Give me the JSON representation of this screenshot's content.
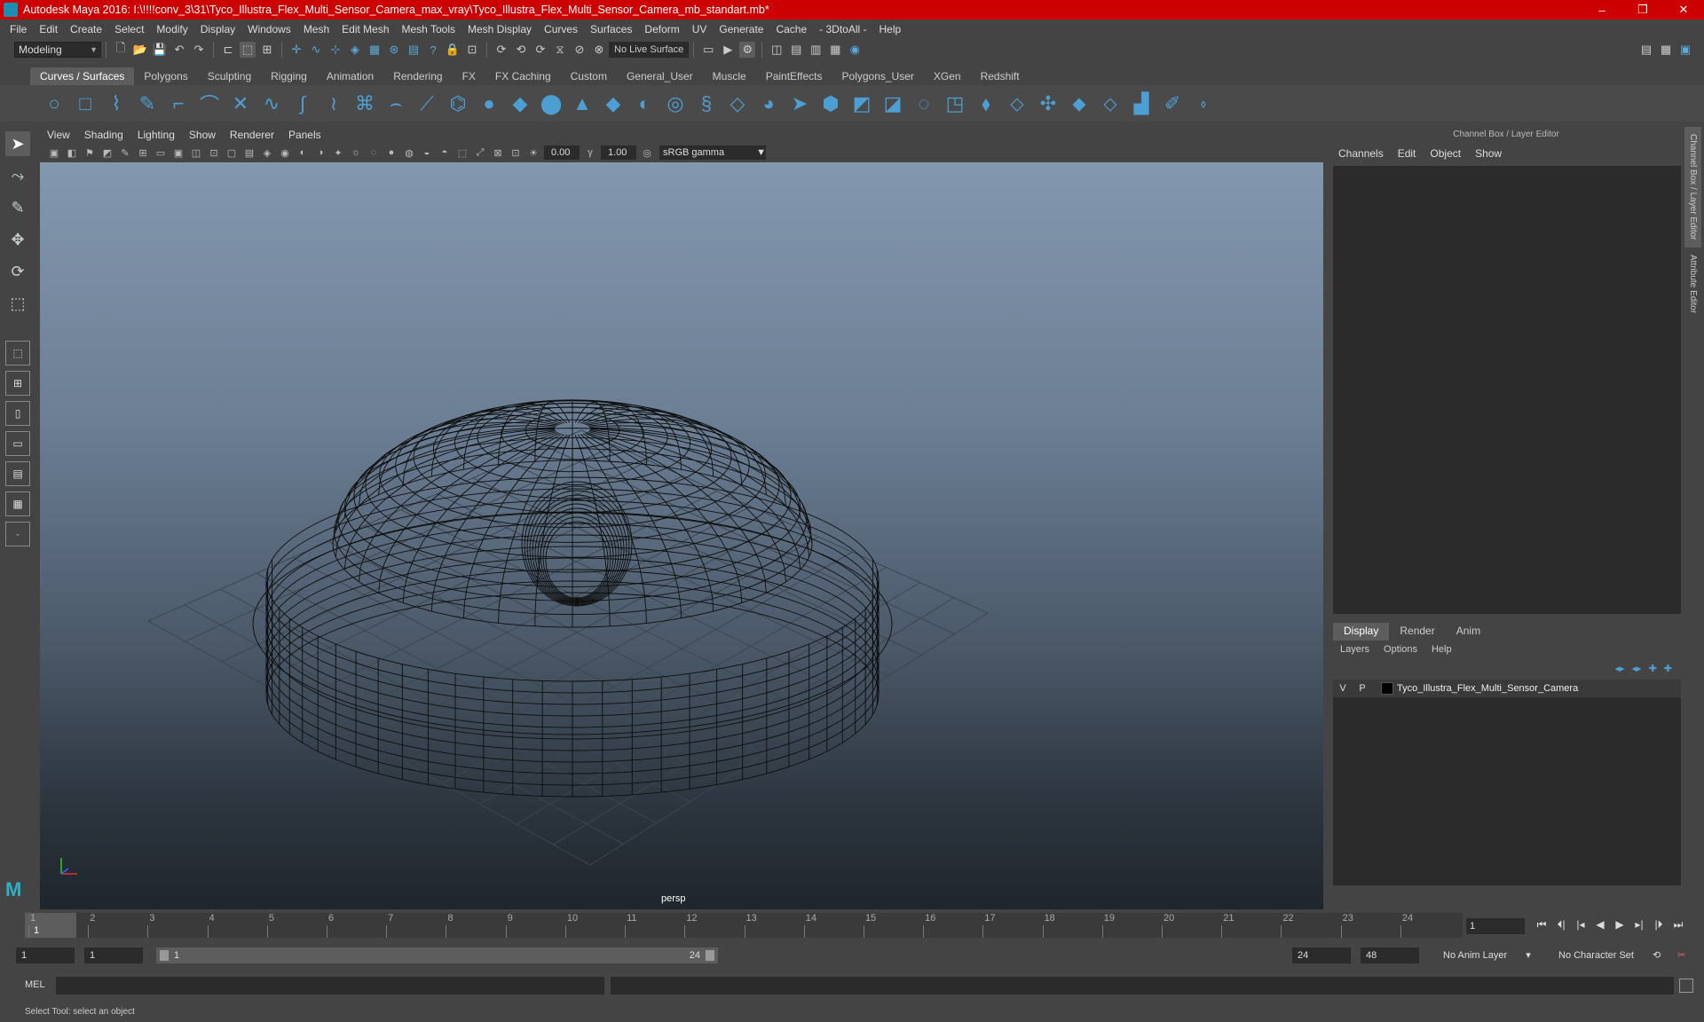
{
  "window": {
    "title": "Autodesk Maya 2016: I:\\!!!!conv_3\\31\\Tyco_Illustra_Flex_Multi_Sensor_Camera_max_vray\\Tyco_Illustra_Flex_Multi_Sensor_Camera_mb_standart.mb*",
    "controls": [
      "–",
      "❐",
      "✕"
    ]
  },
  "menubar": [
    "File",
    "Edit",
    "Create",
    "Select",
    "Modify",
    "Display",
    "Windows",
    "Mesh",
    "Edit Mesh",
    "Mesh Tools",
    "Mesh Display",
    "Curves",
    "Surfaces",
    "Deform",
    "UV",
    "Generate",
    "Cache",
    "- 3DtoAll -",
    "Help"
  ],
  "statusline": {
    "mode": "Modeling",
    "live_surface": "No Live Surface"
  },
  "shelf": {
    "tabs": [
      "Curves / Surfaces",
      "Polygons",
      "Sculpting",
      "Rigging",
      "Animation",
      "Rendering",
      "FX",
      "FX Caching",
      "Custom",
      "General_User",
      "Muscle",
      "PaintEffects",
      "Polygons_User",
      "XGen",
      "Redshift"
    ],
    "active_tab": "Curves / Surfaces"
  },
  "viewport": {
    "menu": [
      "View",
      "Shading",
      "Lighting",
      "Show",
      "Renderer",
      "Panels"
    ],
    "exposure": "0.00",
    "gamma": "1.00",
    "colorspace": "sRGB gamma",
    "camera_label": "persp"
  },
  "channelbox": {
    "header": "Channel Box / Layer Editor",
    "menu": [
      "Channels",
      "Edit",
      "Object",
      "Show"
    ]
  },
  "layers": {
    "tabs": [
      "Display",
      "Render",
      "Anim"
    ],
    "active_tab": "Display",
    "menu": [
      "Layers",
      "Options",
      "Help"
    ],
    "rows": [
      {
        "v": "V",
        "p": "P",
        "name": "Tyco_Illustra_Flex_Multi_Sensor_Camera"
      }
    ]
  },
  "side_tabs": [
    "Channel Box / Layer Editor",
    "Attribute Editor"
  ],
  "timeline": {
    "ticks": [
      "1",
      "2",
      "3",
      "4",
      "5",
      "6",
      "7",
      "8",
      "9",
      "10",
      "11",
      "12",
      "13",
      "14",
      "15",
      "16",
      "17",
      "18",
      "19",
      "20",
      "21",
      "22",
      "23",
      "24"
    ],
    "current_frame": "1",
    "frame_field": "1"
  },
  "range": {
    "start": "1",
    "playback_start": "1",
    "slider_start": "1",
    "slider_end": "24",
    "playback_end": "24",
    "end": "48",
    "anim_layer": "No Anim Layer",
    "character_set": "No Character Set"
  },
  "cmdline": {
    "label": "MEL"
  },
  "helpline": "Select Tool: select an object",
  "colors": {
    "title_bar": "#cc0000",
    "accent": "#4d9fd3",
    "panel": "#444444"
  }
}
